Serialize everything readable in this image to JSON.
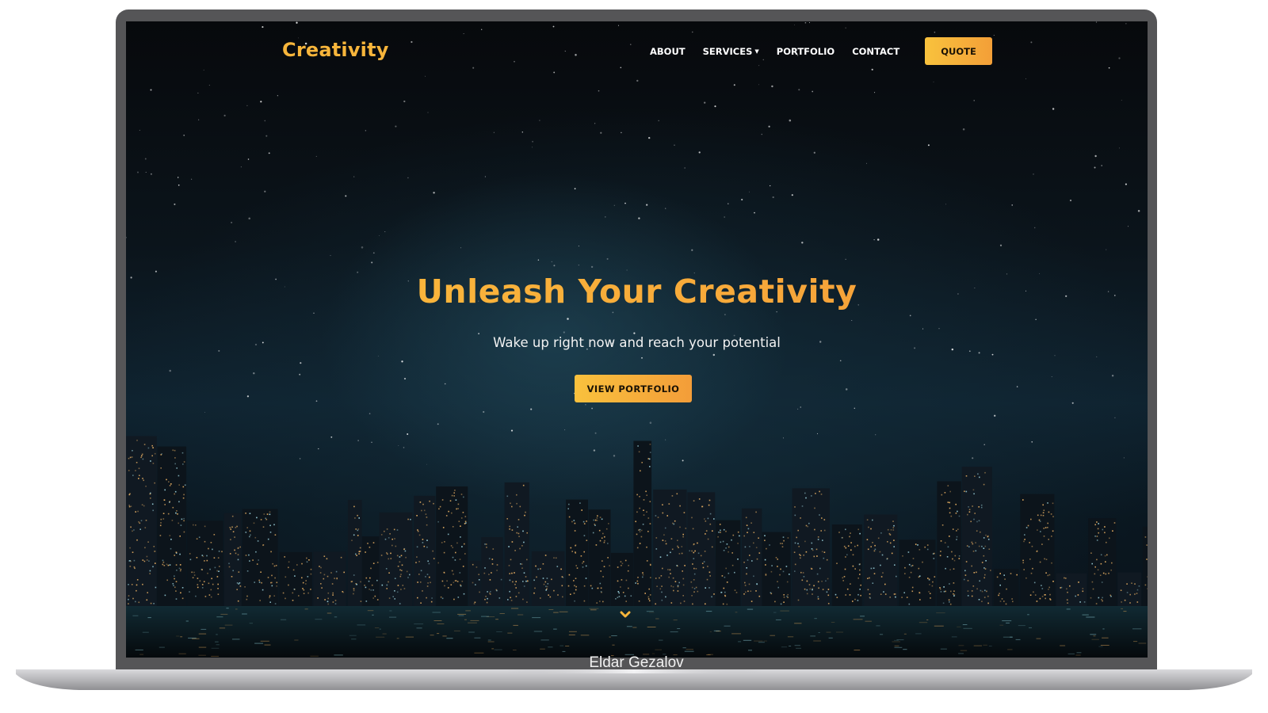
{
  "brand": {
    "name": "Creativity"
  },
  "nav": {
    "items": [
      {
        "label": "ABOUT",
        "dropdown": false
      },
      {
        "label": "SERVICES",
        "dropdown": true
      },
      {
        "label": "PORTFOLIO",
        "dropdown": false
      },
      {
        "label": "CONTACT",
        "dropdown": false
      }
    ],
    "quote_label": "QUOTE"
  },
  "hero": {
    "title": "Unleash Your Creativity",
    "subtitle": "Wake up right now and reach your potential",
    "cta_label": "VIEW PORTFOLIO",
    "scroll_icon": "chevron-down-icon"
  },
  "caption": "Eldar Gezalov",
  "colors": {
    "accent_start": "#f8c23d",
    "accent_end": "#f39f38",
    "brand": "#f7b53b",
    "frame": "#555557",
    "sky": "#0b141b"
  }
}
